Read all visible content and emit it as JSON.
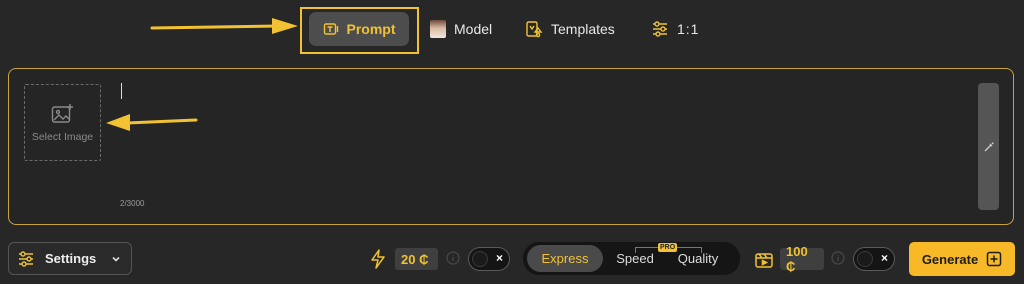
{
  "top_tabs": {
    "prompt_label": "Prompt",
    "model_label": "Model",
    "templates_label": "Templates",
    "ratio_label": "1:1"
  },
  "editor": {
    "select_image_label": "Select Image",
    "char_count": "2/3000",
    "prompt_value": ""
  },
  "bottom_bar": {
    "settings_label": "Settings",
    "express_credits": "20 ₵",
    "modes": [
      "Express",
      "Speed",
      "Quality"
    ],
    "selected_mode": "Express",
    "pro_badge": "PRO",
    "video_credits": "100 ₵",
    "toggle_off_symbol": "×",
    "generate_label": "Generate"
  },
  "colors": {
    "accent": "#f2c232",
    "background": "#272727",
    "generate_button": "#f7b928"
  }
}
